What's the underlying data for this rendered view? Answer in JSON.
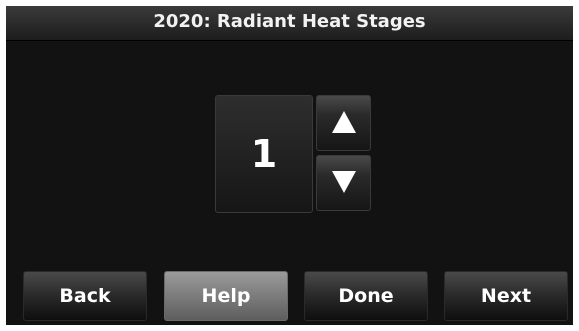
{
  "header": {
    "title": "2020: Radiant Heat Stages"
  },
  "setting": {
    "value": "1"
  },
  "icons": {
    "increase": "arrow-up-icon",
    "decrease": "arrow-down-icon"
  },
  "buttons": {
    "back": "Back",
    "help": "Help",
    "done": "Done",
    "next": "Next"
  },
  "colors": {
    "background": "#121212",
    "text": "#ffffff",
    "help_button": "#7c7c7c"
  }
}
